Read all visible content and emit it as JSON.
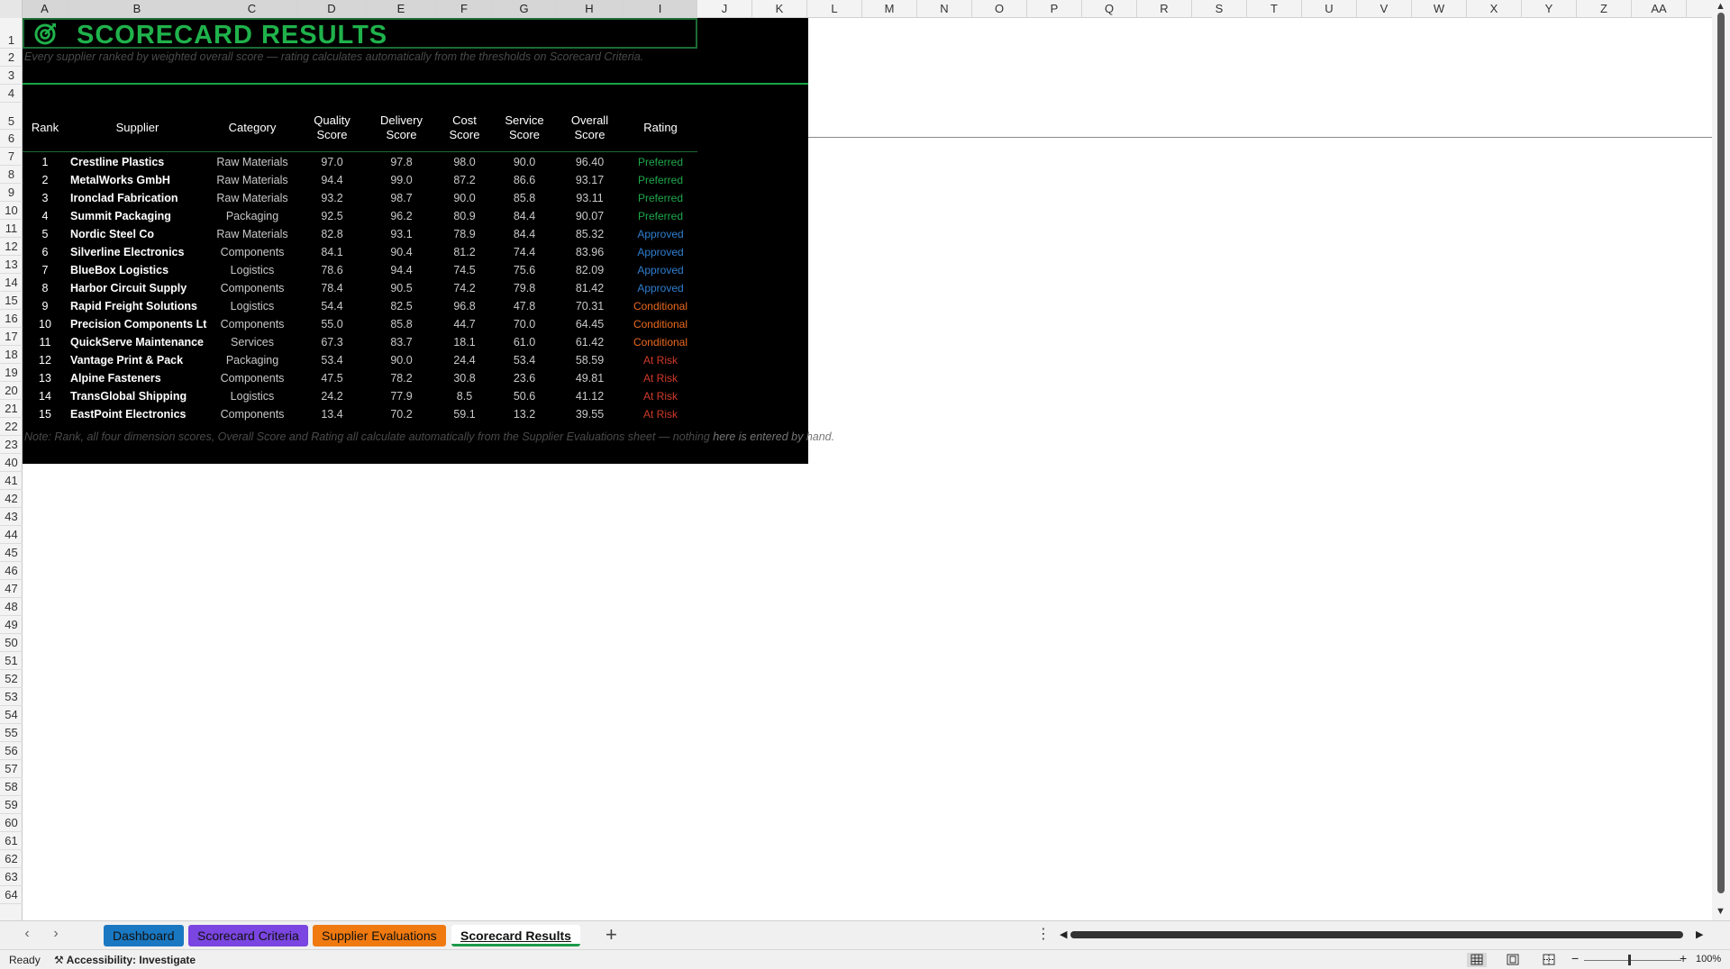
{
  "columns": [
    "A",
    "B",
    "C",
    "D",
    "E",
    "F",
    "G",
    "H",
    "I",
    "J",
    "K",
    "L",
    "M",
    "N",
    "O",
    "P",
    "Q",
    "R",
    "S",
    "T",
    "U",
    "V",
    "W",
    "X",
    "Y",
    "Z",
    "AA"
  ],
  "rows": [
    "1",
    "2",
    "3",
    "4",
    "5",
    "6",
    "7",
    "8",
    "9",
    "10",
    "11",
    "12",
    "13",
    "14",
    "15",
    "16",
    "17",
    "18",
    "19",
    "20",
    "21",
    "22",
    "23",
    "40",
    "41",
    "42",
    "43",
    "44",
    "45",
    "46",
    "47",
    "48",
    "49",
    "50",
    "51",
    "52",
    "53",
    "54",
    "55",
    "56",
    "57",
    "58",
    "59",
    "60",
    "61",
    "62",
    "63",
    "64"
  ],
  "sheet": {
    "title": "SCORECARD RESULTS",
    "subtitle": "Every supplier ranked by weighted overall score — rating calculates automatically from the thresholds on Scorecard Criteria.",
    "headers": [
      "Rank",
      "Supplier",
      "Category",
      "Quality\nScore",
      "Delivery\nScore",
      "Cost\nScore",
      "Service\nScore",
      "Overall\nScore",
      "Rating"
    ],
    "note_main": "Note: Rank, all four dimension scores, Overall Score and Rating all calculate automatically from the Supplier Evaluations sheet — nothing ",
    "note_overflow": "here is entered by hand.",
    "rating_colors": {
      "Preferred": "#1fa84a",
      "Approved": "#2f7fd0",
      "Conditional": "#ec6a1e",
      "At Risk": "#d23a2a"
    },
    "rows": [
      [
        "1",
        "Crestline Plastics",
        "Raw Materials",
        "97.0",
        "97.8",
        "98.0",
        "90.0",
        "96.40",
        "Preferred"
      ],
      [
        "2",
        "MetalWorks GmbH",
        "Raw Materials",
        "94.4",
        "99.0",
        "87.2",
        "86.6",
        "93.17",
        "Preferred"
      ],
      [
        "3",
        "Ironclad Fabrication",
        "Raw Materials",
        "93.2",
        "98.7",
        "90.0",
        "85.8",
        "93.11",
        "Preferred"
      ],
      [
        "4",
        "Summit Packaging",
        "Packaging",
        "92.5",
        "96.2",
        "80.9",
        "84.4",
        "90.07",
        "Preferred"
      ],
      [
        "5",
        "Nordic Steel Co",
        "Raw Materials",
        "82.8",
        "93.1",
        "78.9",
        "84.4",
        "85.32",
        "Approved"
      ],
      [
        "6",
        "Silverline Electronics",
        "Components",
        "84.1",
        "90.4",
        "81.2",
        "74.4",
        "83.96",
        "Approved"
      ],
      [
        "7",
        "BlueBox Logistics",
        "Logistics",
        "78.6",
        "94.4",
        "74.5",
        "75.6",
        "82.09",
        "Approved"
      ],
      [
        "8",
        "Harbor Circuit Supply",
        "Components",
        "78.4",
        "90.5",
        "74.2",
        "79.8",
        "81.42",
        "Approved"
      ],
      [
        "9",
        "Rapid Freight Solutions",
        "Logistics",
        "54.4",
        "82.5",
        "96.8",
        "47.8",
        "70.31",
        "Conditional"
      ],
      [
        "10",
        "Precision Components Ltd",
        "Components",
        "55.0",
        "85.8",
        "44.7",
        "70.0",
        "64.45",
        "Conditional"
      ],
      [
        "11",
        "QuickServe Maintenance",
        "Services",
        "67.3",
        "83.7",
        "18.1",
        "61.0",
        "61.42",
        "Conditional"
      ],
      [
        "12",
        "Vantage Print & Pack",
        "Packaging",
        "53.4",
        "90.0",
        "24.4",
        "53.4",
        "58.59",
        "At Risk"
      ],
      [
        "13",
        "Alpine Fasteners",
        "Components",
        "47.5",
        "78.2",
        "30.8",
        "23.6",
        "49.81",
        "At Risk"
      ],
      [
        "14",
        "TransGlobal Shipping",
        "Logistics",
        "24.2",
        "77.9",
        "8.5",
        "50.6",
        "41.12",
        "At Risk"
      ],
      [
        "15",
        "EastPoint Electronics",
        "Components",
        "13.4",
        "70.2",
        "59.1",
        "13.2",
        "39.55",
        "At Risk"
      ]
    ]
  },
  "tabs": [
    {
      "label": "Dashboard",
      "color": "#1a78c2",
      "active": false
    },
    {
      "label": "Scorecard Criteria",
      "color": "#7a45e0",
      "active": false
    },
    {
      "label": "Supplier Evaluations",
      "color": "#f07a10",
      "active": false
    },
    {
      "label": "Scorecard Results",
      "color": "#ffffff",
      "active": true
    }
  ],
  "status": {
    "ready": "Ready",
    "accessibility": "Accessibility: Investigate",
    "zoom": "100%"
  }
}
